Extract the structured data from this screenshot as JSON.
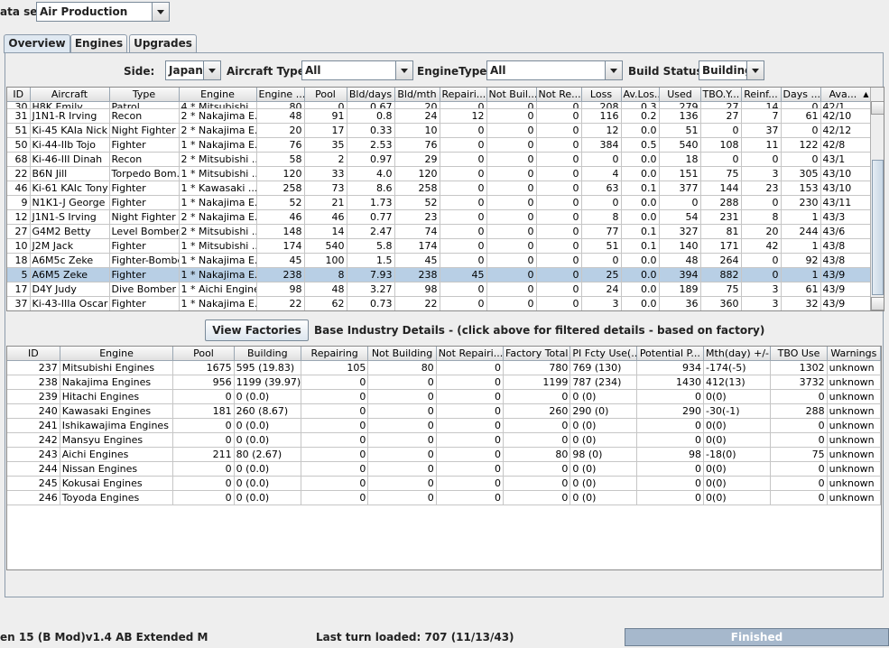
{
  "toolbar": {
    "dataset_label": "ata set:",
    "dataset_value": "Air Production"
  },
  "tabs": [
    {
      "label": "Overview"
    },
    {
      "label": "Engines"
    },
    {
      "label": "Upgrades"
    }
  ],
  "filters": {
    "side_label": "Side:",
    "side_value": "Japan",
    "aircraft_type_label": "Aircraft Type:",
    "aircraft_type_value": "All",
    "engine_type_label": "EngineType:",
    "engine_type_value": "All",
    "build_status_label": "Build Status:",
    "build_status_value": "Building"
  },
  "aircraft_table": {
    "columns": [
      "ID",
      "Aircraft",
      "Type",
      "Engine",
      "Engine ...",
      "Pool",
      "Bld/days",
      "Bld/mth",
      "Repairi...",
      "Not Buil...",
      "Not Re...",
      "Loss",
      "Av.Los...",
      "Used",
      "TBO.Y...",
      "Reinf...",
      "Days ...",
      "Ava..."
    ],
    "sort_indicator": "▲",
    "partial_row": [
      "30",
      "H8K Emily",
      "Patrol",
      "4 * Mitsubishi ...",
      "80",
      "0",
      "0.67",
      "20",
      "0",
      "0",
      "0",
      "208",
      "0.3",
      "279",
      "27",
      "14",
      "0",
      "42/1"
    ],
    "rows": [
      [
        "31",
        "J1N1-R Irving",
        "Recon",
        "2 * Nakajima E...",
        "48",
        "91",
        "0.8",
        "24",
        "12",
        "0",
        "0",
        "116",
        "0.2",
        "136",
        "27",
        "7",
        "61",
        "42/10"
      ],
      [
        "51",
        "Ki-45 KAIa Nick",
        "Night Fighter",
        "2 * Nakajima E...",
        "20",
        "17",
        "0.33",
        "10",
        "0",
        "0",
        "0",
        "12",
        "0.0",
        "51",
        "0",
        "37",
        "0",
        "42/12"
      ],
      [
        "50",
        "Ki-44-IIb Tojo",
        "Fighter",
        "1 * Nakajima E...",
        "76",
        "35",
        "2.53",
        "76",
        "0",
        "0",
        "0",
        "384",
        "0.5",
        "540",
        "108",
        "11",
        "122",
        "42/8"
      ],
      [
        "68",
        "Ki-46-III Dinah",
        "Recon",
        "2 * Mitsubishi ...",
        "58",
        "2",
        "0.97",
        "29",
        "0",
        "0",
        "0",
        "0",
        "0.0",
        "18",
        "0",
        "0",
        "0",
        "43/1"
      ],
      [
        "22",
        "B6N Jill",
        "Torpedo Bom...",
        "1 * Mitsubishi ...",
        "120",
        "33",
        "4.0",
        "120",
        "0",
        "0",
        "0",
        "4",
        "0.0",
        "151",
        "75",
        "3",
        "305",
        "43/10"
      ],
      [
        "46",
        "Ki-61 KAIc Tony",
        "Fighter",
        "1 * Kawasaki ...",
        "258",
        "73",
        "8.6",
        "258",
        "0",
        "0",
        "0",
        "63",
        "0.1",
        "377",
        "144",
        "23",
        "153",
        "43/10"
      ],
      [
        "9",
        "N1K1-J George",
        "Fighter",
        "1 * Nakajima E...",
        "52",
        "21",
        "1.73",
        "52",
        "0",
        "0",
        "0",
        "0",
        "0.0",
        "0",
        "288",
        "0",
        "230",
        "43/11"
      ],
      [
        "12",
        "J1N1-S Irving",
        "Night Fighter",
        "2 * Nakajima E...",
        "46",
        "46",
        "0.77",
        "23",
        "0",
        "0",
        "0",
        "8",
        "0.0",
        "54",
        "231",
        "8",
        "1",
        "43/3"
      ],
      [
        "27",
        "G4M2 Betty",
        "Level Bomber",
        "2 * Mitsubishi ...",
        "148",
        "14",
        "2.47",
        "74",
        "0",
        "0",
        "0",
        "77",
        "0.1",
        "327",
        "81",
        "20",
        "244",
        "43/6"
      ],
      [
        "10",
        "J2M Jack",
        "Fighter",
        "1 * Mitsubishi ...",
        "174",
        "540",
        "5.8",
        "174",
        "0",
        "0",
        "0",
        "51",
        "0.1",
        "140",
        "171",
        "42",
        "1",
        "43/8"
      ],
      [
        "18",
        "A6M5c Zeke",
        "Fighter-Bomber",
        "1 * Nakajima E...",
        "45",
        "100",
        "1.5",
        "45",
        "0",
        "0",
        "0",
        "0",
        "0.0",
        "48",
        "264",
        "0",
        "92",
        "43/8"
      ],
      [
        "5",
        "A6M5 Zeke",
        "Fighter",
        "1 * Nakajima E...",
        "238",
        "8",
        "7.93",
        "238",
        "45",
        "0",
        "0",
        "25",
        "0.0",
        "394",
        "882",
        "0",
        "1",
        "43/9"
      ],
      [
        "17",
        "D4Y Judy",
        "Dive Bomber",
        "1 * Aichi Engines",
        "98",
        "48",
        "3.27",
        "98",
        "0",
        "0",
        "0",
        "24",
        "0.0",
        "189",
        "75",
        "3",
        "61",
        "43/9"
      ],
      [
        "37",
        "Ki-43-IIIa Oscar",
        "Fighter",
        "1 * Nakajima E...",
        "22",
        "62",
        "0.73",
        "22",
        "0",
        "0",
        "0",
        "3",
        "0.0",
        "36",
        "360",
        "3",
        "32",
        "43/9"
      ]
    ],
    "selected_index": 11
  },
  "middle": {
    "view_factories_label": "View Factories",
    "details_text": "Base Industry Details - (click above for filtered details - based on factory)"
  },
  "engine_table": {
    "columns": [
      "ID",
      "Engine",
      "Pool",
      "Building",
      "Repairing",
      "Not Building",
      "Not Repairi...",
      "Factory Total",
      "PI Fcty Use(...",
      "Potential P...",
      "Mth(day) +/-",
      "TBO Use",
      "Warnings"
    ],
    "rows": [
      [
        "237",
        "Mitsubishi Engines",
        "1675",
        "595 (19.83)",
        "105",
        "80",
        "0",
        "780",
        "769 (130)",
        "934",
        "-174(-5)",
        "1302",
        "unknown"
      ],
      [
        "238",
        "Nakajima Engines",
        "956",
        "1199 (39.97)",
        "0",
        "0",
        "0",
        "1199",
        "787 (234)",
        "1430",
        "412(13)",
        "3732",
        "unknown"
      ],
      [
        "239",
        "Hitachi Engines",
        "0",
        "0 (0.0)",
        "0",
        "0",
        "0",
        "0",
        "0 (0)",
        "0",
        "0(0)",
        "0",
        "unknown"
      ],
      [
        "240",
        "Kawasaki Engines",
        "181",
        "260 (8.67)",
        "0",
        "0",
        "0",
        "260",
        "290 (0)",
        "290",
        "-30(-1)",
        "288",
        "unknown"
      ],
      [
        "241",
        "Ishikawajima Engines",
        "0",
        "0 (0.0)",
        "0",
        "0",
        "0",
        "0",
        "0 (0)",
        "0",
        "0(0)",
        "0",
        "unknown"
      ],
      [
        "242",
        "Mansyu Engines",
        "0",
        "0 (0.0)",
        "0",
        "0",
        "0",
        "0",
        "0 (0)",
        "0",
        "0(0)",
        "0",
        "unknown"
      ],
      [
        "243",
        "Aichi Engines",
        "211",
        "80 (2.67)",
        "0",
        "0",
        "0",
        "80",
        "98 (0)",
        "98",
        "-18(0)",
        "75",
        "unknown"
      ],
      [
        "244",
        "Nissan Engines",
        "0",
        "0 (0.0)",
        "0",
        "0",
        "0",
        "0",
        "0 (0)",
        "0",
        "0(0)",
        "0",
        "unknown"
      ],
      [
        "245",
        "Kokusai Engines",
        "0",
        "0 (0.0)",
        "0",
        "0",
        "0",
        "0",
        "0 (0)",
        "0",
        "0(0)",
        "0",
        "unknown"
      ],
      [
        "246",
        "Toyoda Engines",
        "0",
        "0 (0.0)",
        "0",
        "0",
        "0",
        "0",
        "0 (0)",
        "0",
        "0(0)",
        "0",
        "unknown"
      ]
    ]
  },
  "statusbar": {
    "version_text": "en 15 (B Mod)v1.4 AB Extended M",
    "last_turn_text": "Last turn loaded: 707 (11/13/43)",
    "progress_text": "Finished"
  }
}
